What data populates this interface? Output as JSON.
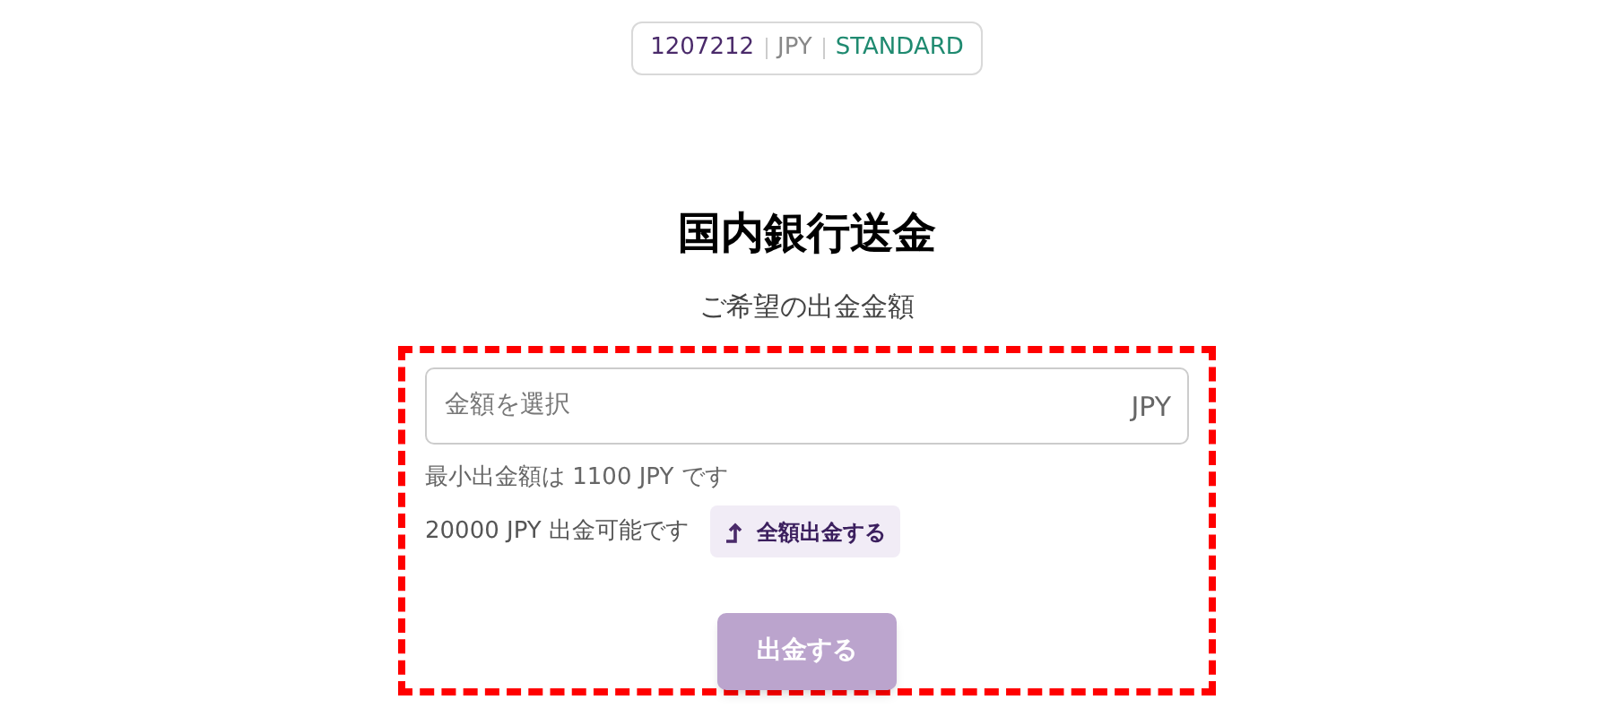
{
  "account": {
    "number": "1207212",
    "currency": "JPY",
    "type": "STANDARD"
  },
  "title": "国内銀行送金",
  "subtitle": "ご希望の出金金額",
  "amount_field": {
    "placeholder": "金額を選択",
    "currency": "JPY"
  },
  "minimum_note": "最小出金額は 1100 JPY です",
  "available_note": "20000 JPY 出金可能です",
  "full_amount_button": {
    "label": "全額出金する"
  },
  "submit_button": {
    "label": "出金する",
    "disabled": true
  },
  "highlighted": true
}
